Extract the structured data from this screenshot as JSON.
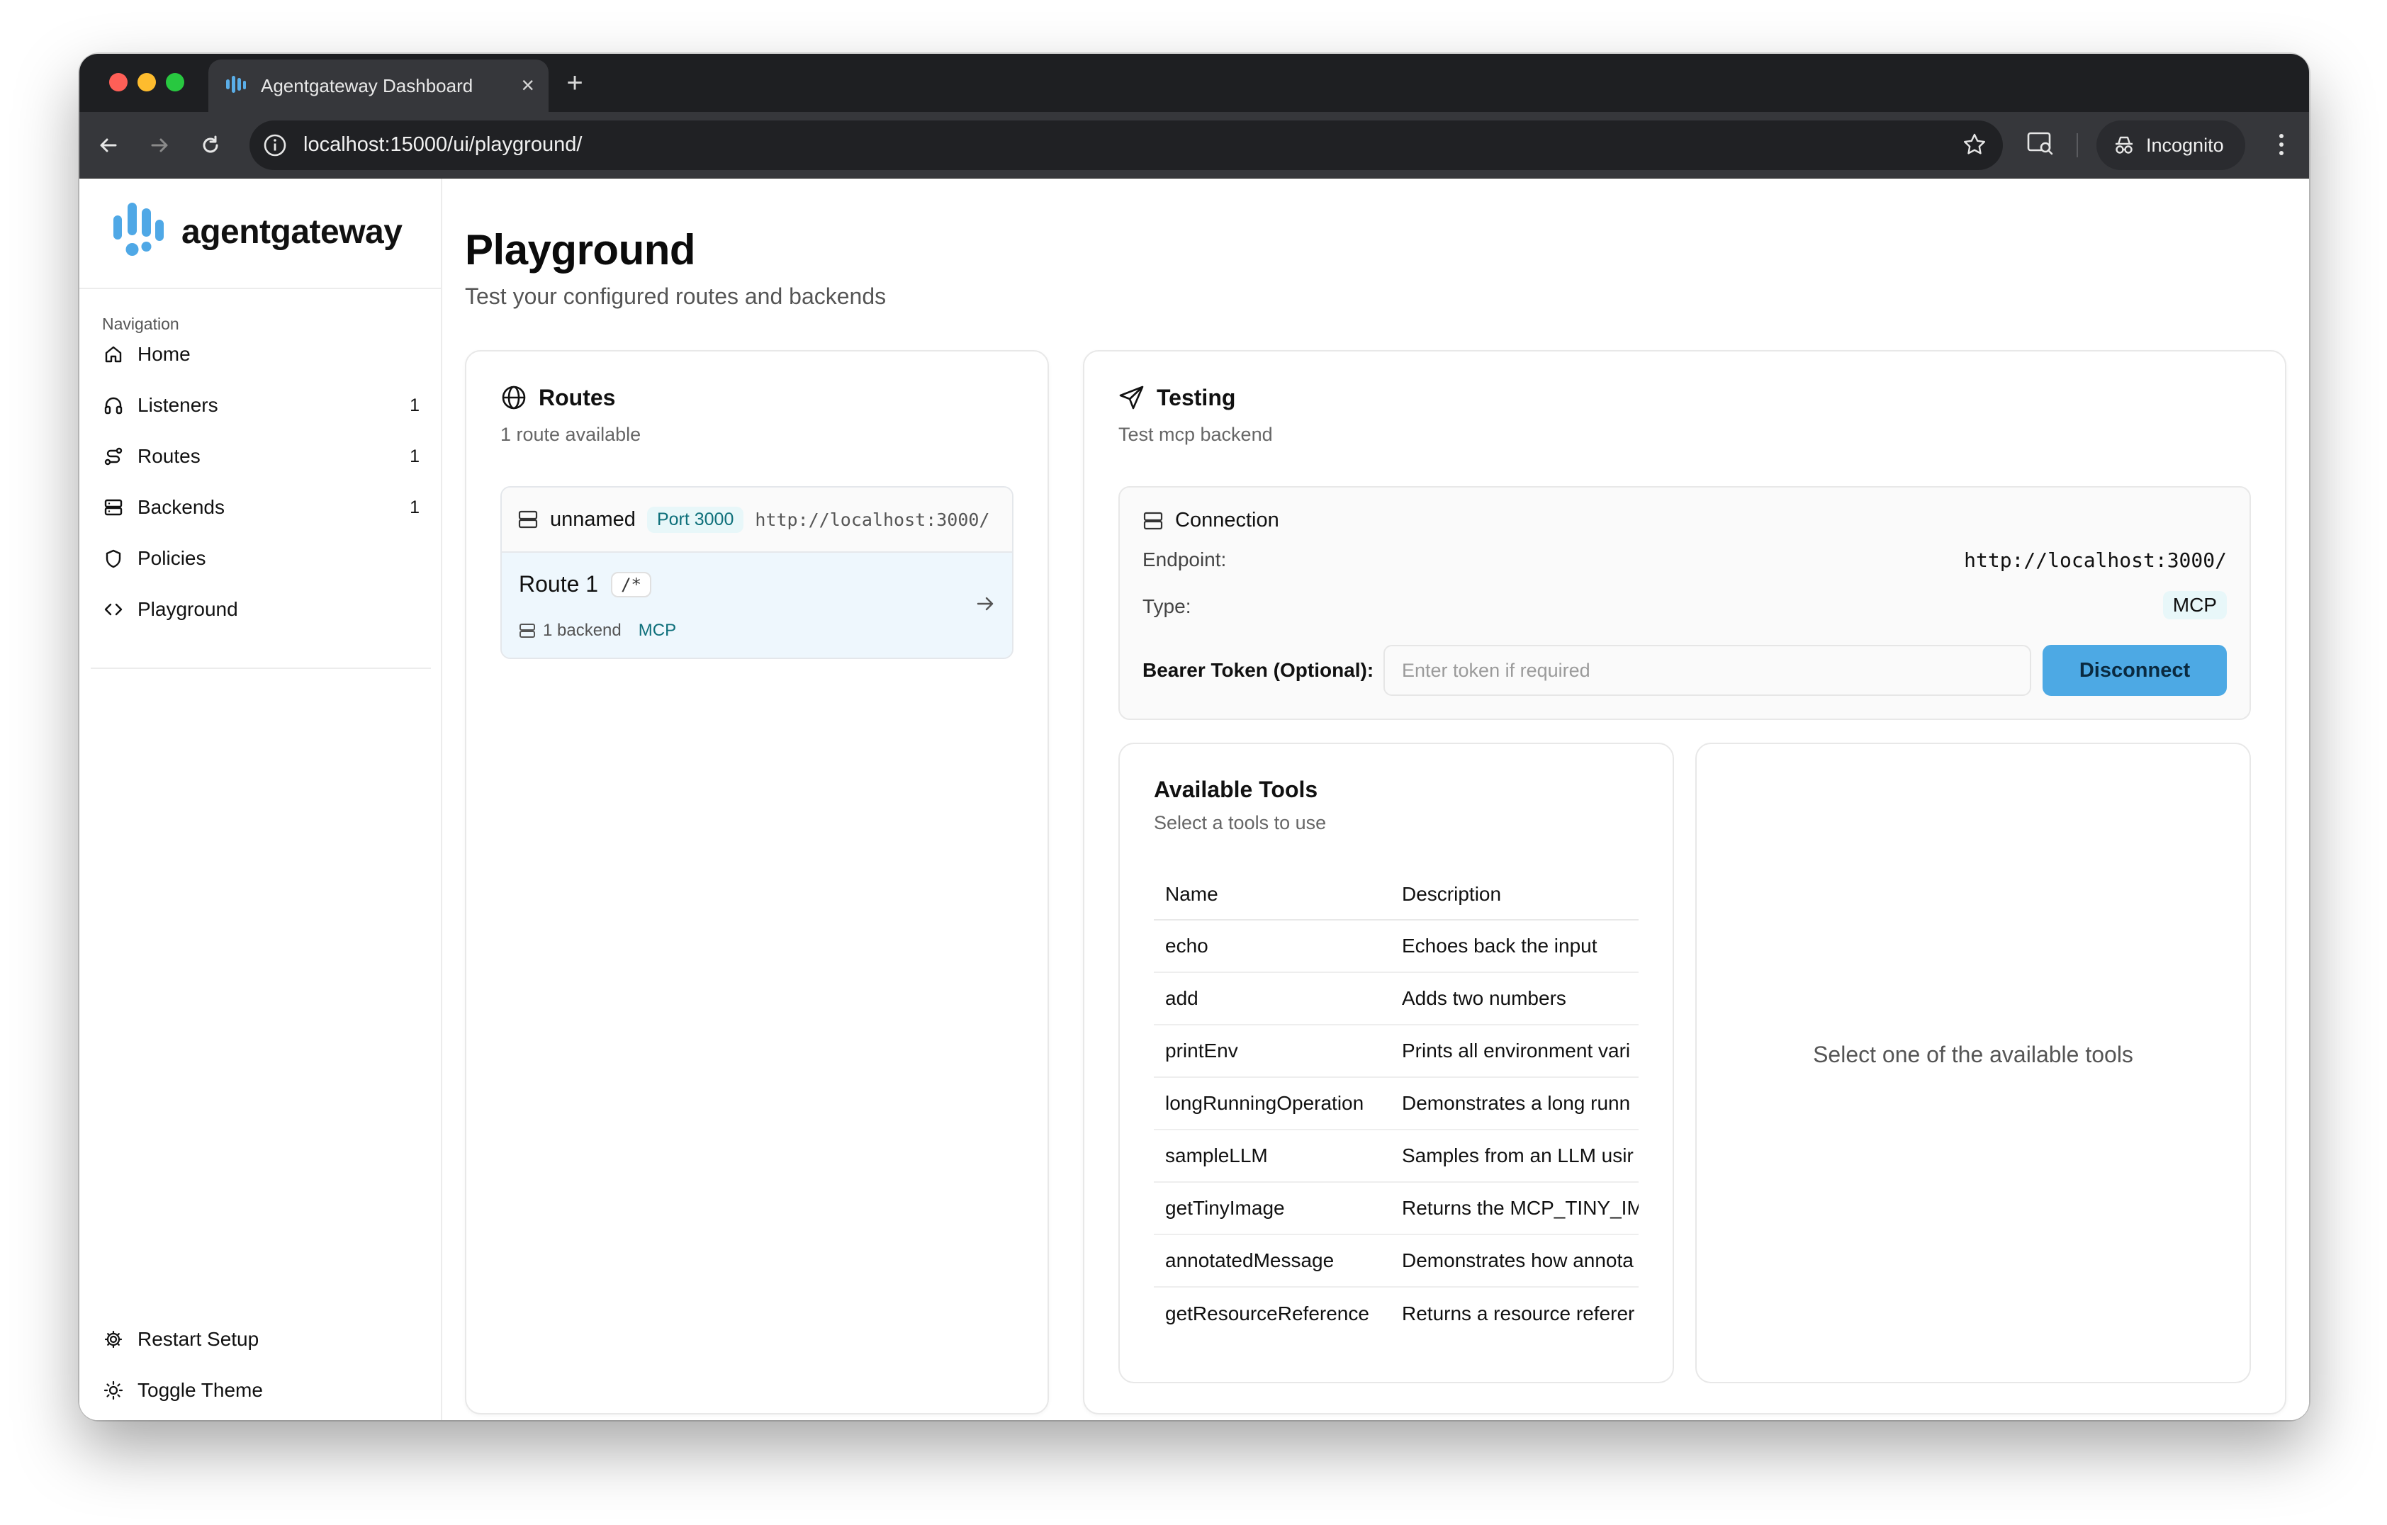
{
  "browser": {
    "tab_title": "Agentgateway Dashboard",
    "url": "localhost:15000/ui/playground/",
    "incognito_label": "Incognito"
  },
  "sidebar": {
    "logo_text": "agentgateway",
    "nav_heading": "Navigation",
    "items": [
      {
        "label": "Home",
        "icon": "home-icon",
        "count": ""
      },
      {
        "label": "Listeners",
        "icon": "headphones-icon",
        "count": "1"
      },
      {
        "label": "Routes",
        "icon": "route-icon",
        "count": "1"
      },
      {
        "label": "Backends",
        "icon": "server-icon",
        "count": "1"
      },
      {
        "label": "Policies",
        "icon": "shield-icon",
        "count": ""
      },
      {
        "label": "Playground",
        "icon": "code-icon",
        "count": ""
      }
    ],
    "footer": [
      {
        "label": "Restart Setup",
        "icon": "gear-icon"
      },
      {
        "label": "Toggle Theme",
        "icon": "sun-icon"
      }
    ]
  },
  "page": {
    "title": "Playground",
    "subtitle": "Test your configured routes and backends"
  },
  "routes_card": {
    "title": "Routes",
    "subtitle": "1 route available",
    "group": {
      "name": "unnamed",
      "port": "Port 3000",
      "url": "http://localhost:3000/"
    },
    "route": {
      "name": "Route 1",
      "path": "/*",
      "backend_count": "1 backend",
      "type": "MCP"
    }
  },
  "testing_card": {
    "title": "Testing",
    "subtitle": "Test mcp backend",
    "connection": {
      "title": "Connection",
      "endpoint_label": "Endpoint:",
      "endpoint_value": "http://localhost:3000/",
      "type_label": "Type:",
      "type_value": "MCP",
      "token_label": "Bearer Token (Optional):",
      "token_placeholder": "Enter token if required",
      "disconnect_label": "Disconnect"
    },
    "tools": {
      "title": "Available Tools",
      "subtitle": "Select a tools to use",
      "columns": [
        "Name",
        "Description"
      ],
      "rows": [
        [
          "echo",
          "Echoes back the input"
        ],
        [
          "add",
          "Adds two numbers"
        ],
        [
          "printEnv",
          "Prints all environment vari"
        ],
        [
          "longRunningOperation",
          "Demonstrates a long runn"
        ],
        [
          "sampleLLM",
          "Samples from an LLM usir"
        ],
        [
          "getTinyImage",
          "Returns the MCP_TINY_IM"
        ],
        [
          "annotatedMessage",
          "Demonstrates how annota"
        ],
        [
          "getResourceReference",
          "Returns a resource referer"
        ]
      ]
    },
    "detail_empty": "Select one of the available tools"
  },
  "colors": {
    "accent": "#4da9e4",
    "badge_bg": "#e8f7f9",
    "badge_text": "#0d6f7a",
    "route_row_bg": "#eef7fd"
  }
}
